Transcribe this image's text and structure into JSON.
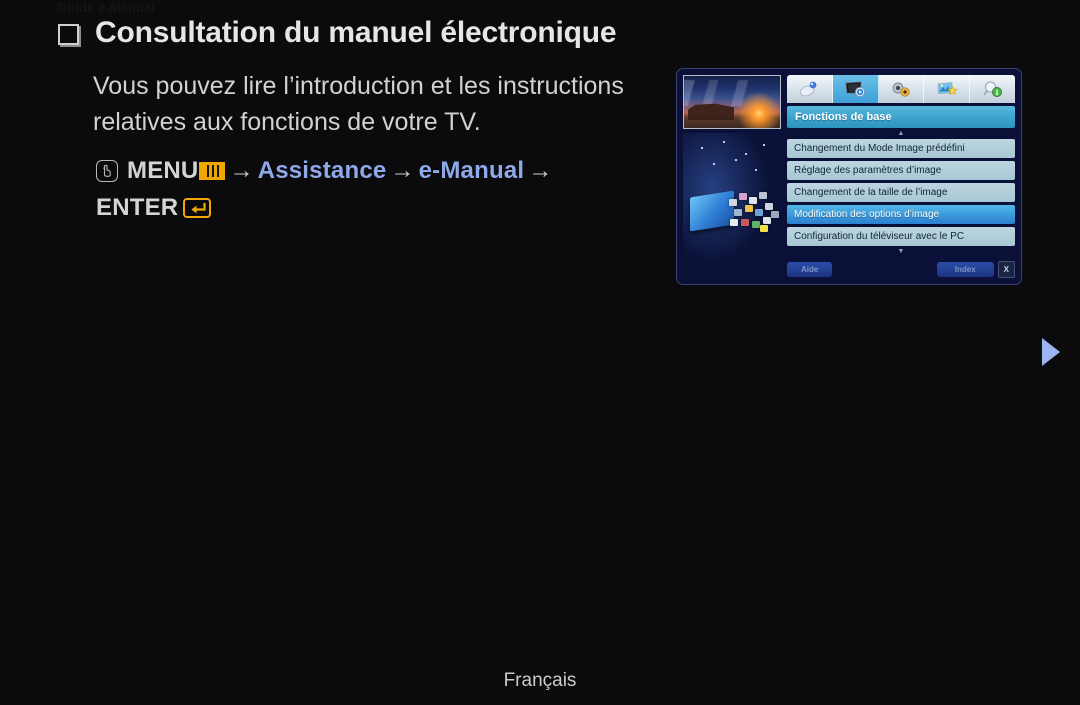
{
  "breadcrumb": "Guide e-Manual",
  "page": {
    "title": "Consultation du manuel électronique",
    "body": "Vous pouvez lire l’introduction et les instructions relatives aux fonctions de votre TV.",
    "language": "Français"
  },
  "nav_path": {
    "hand_icon": "remote-press-icon",
    "menu_label": "MENU",
    "menu_icon": "menu-bars-icon",
    "arrow": "→",
    "step_assistance": "Assistance",
    "step_emanual": "e-Manual",
    "enter_label": "ENTER",
    "enter_icon": "enter-return-icon",
    "accent_blue": "#8fa8ea",
    "accent_yellow": "#f0a800"
  },
  "next_arrow": {
    "icon": "play-triangle-right-icon",
    "color": "#9db4f2"
  },
  "tv_panel": {
    "thumbnails": [
      {
        "name": "sunset-barn-photo"
      },
      {
        "name": "tv-with-apps-photo"
      }
    ],
    "tabs": [
      {
        "icon": "satellite-dish-icon",
        "selected": false
      },
      {
        "icon": "tv-playback-icon",
        "selected": true
      },
      {
        "icon": "gears-settings-icon",
        "selected": false
      },
      {
        "icon": "picture-star-icon",
        "selected": false
      },
      {
        "icon": "magnifier-info-icon",
        "selected": false
      }
    ],
    "section_title": "Fonctions de base",
    "menu_items": [
      {
        "label": "Changement du Mode Image prédéfini",
        "active": false
      },
      {
        "label": "Réglage des paramètres d’image",
        "active": false
      },
      {
        "label": "Changement de la taille de l’image",
        "active": false
      },
      {
        "label": "Modification des options d’image",
        "active": true
      },
      {
        "label": "Configuration du téléviseur avec le PC",
        "active": false
      }
    ],
    "footer": {
      "help_label": "Aide",
      "index_label": "Index",
      "close_label": "X"
    }
  }
}
